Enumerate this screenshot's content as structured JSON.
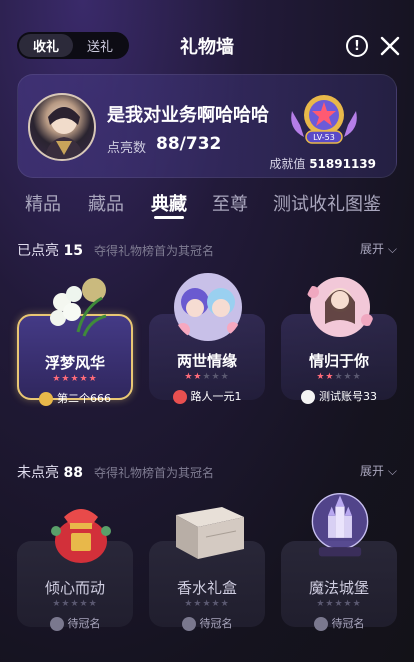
{
  "header": {
    "tabs": [
      "收礼",
      "送礼"
    ],
    "title": "礼物墙"
  },
  "profile": {
    "username": "是我对业务啊哈哈哈",
    "points_label": "点亮数",
    "points_value": "88/732",
    "level": "LV-53",
    "achievement_label": "成就值",
    "achievement_value": "51891139"
  },
  "category_tabs": [
    {
      "label": "精品"
    },
    {
      "label": "藏品"
    },
    {
      "label": "典藏",
      "active": true
    },
    {
      "label": "至尊"
    },
    {
      "label": "测试收礼图鉴"
    }
  ],
  "lit_section": {
    "title": "已点亮",
    "count": "15",
    "subtitle": "夺得礼物榜首为其冠名",
    "expand": "展开"
  },
  "lit_items": [
    {
      "name": "浮梦风华",
      "stars": 5,
      "owner": "第二个666"
    },
    {
      "name": "两世情缘",
      "stars": 2,
      "owner": "路人一元1"
    },
    {
      "name": "情归于你",
      "stars": 2,
      "owner": "测试账号33"
    }
  ],
  "unlit_section": {
    "title": "未点亮",
    "count": "88",
    "subtitle": "夺得礼物榜首为其冠名",
    "expand": "展开"
  },
  "unlit_items": [
    {
      "name": "倾心而动",
      "owner": "待冠名"
    },
    {
      "name": "香水礼盒",
      "owner": "待冠名"
    },
    {
      "name": "魔法城堡",
      "owner": "待冠名"
    }
  ],
  "colors": {
    "accent_gold": "#e9c774",
    "star_on": "#ff6b7a",
    "background": "#15131f"
  }
}
